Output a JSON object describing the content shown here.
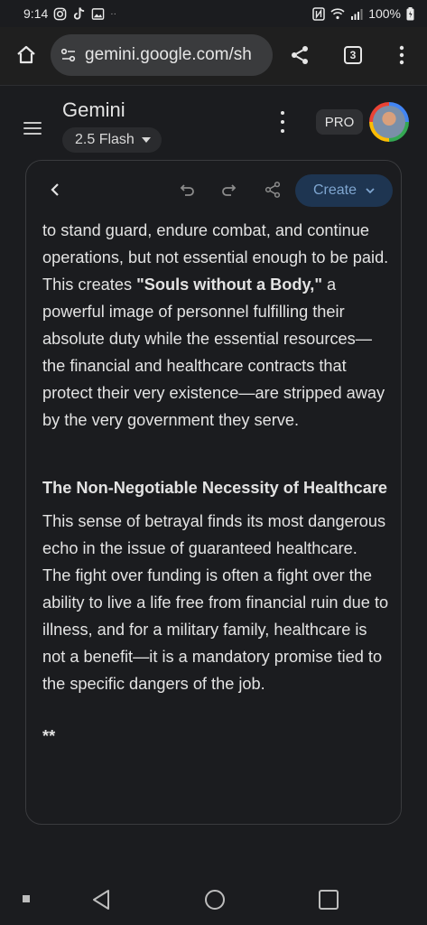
{
  "status_bar": {
    "time": "9:14",
    "battery": "100%",
    "dots": "··"
  },
  "browser": {
    "url": "gemini.google.com/sh",
    "tab_count": "3"
  },
  "app": {
    "title": "Gemini",
    "model": "2.5 Flash",
    "pro_badge": "PRO"
  },
  "toolbar": {
    "create_label": "Create"
  },
  "document": {
    "para1_before": "to stand guard, endure combat, and continue operations, but not essential enough to be paid. This creates ",
    "para1_bold": "\"Souls without a Body,\"",
    "para1_after": " a powerful image of personnel fulfilling their absolute duty while the essential resources—the financial and healthcare contracts that protect their very existence—are stripped away by the very government they serve.",
    "heading": "The Non-Negotiable Necessity of Healthcare",
    "para2": "This sense of betrayal finds its most dangerous echo in the issue of guaranteed healthcare. The fight over funding is often a fight over the ability to live a life free from financial ruin due to illness, and for a military family, healthcare is not a benefit—it is a mandatory promise tied to the specific dangers of the job.",
    "trailing": "**"
  }
}
